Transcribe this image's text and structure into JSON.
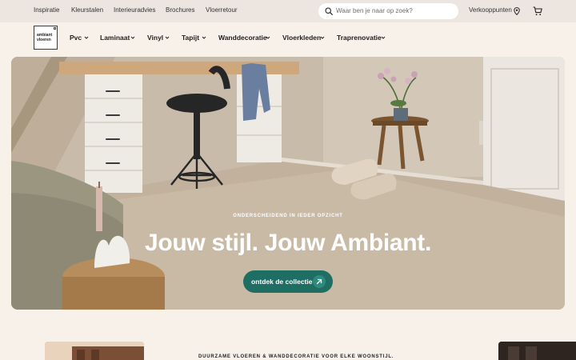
{
  "topbar": {
    "links": [
      "Inspiratie",
      "Kleurstalen",
      "Interieuradvies",
      "Brochures",
      "Vloerretour"
    ],
    "search_placeholder": "Waar ben je naar op zoek?",
    "stores_label": "Verkooppunten"
  },
  "logo": {
    "line1": "ambiant",
    "line2": "vloeren"
  },
  "nav": {
    "items": [
      "Pvc",
      "Laminaat",
      "Vinyl",
      "Tapijt",
      "Wanddecoratie",
      "Vloerkleden",
      "Traprenovatie"
    ]
  },
  "hero": {
    "kicker": "ONDERSCHEIDEND IN IEDER OPZICHT",
    "title": "Jouw stijl. Jouw Ambiant.",
    "cta_label": "ontdek de collectie"
  },
  "section": {
    "tagline": "DUURZAME VLOEREN & WANDDECORATIE VOOR ELKE WOONSTIJL."
  },
  "colors": {
    "background": "#f8f1ea",
    "topbar": "#ede6e0",
    "cta": "#1f6e63"
  }
}
